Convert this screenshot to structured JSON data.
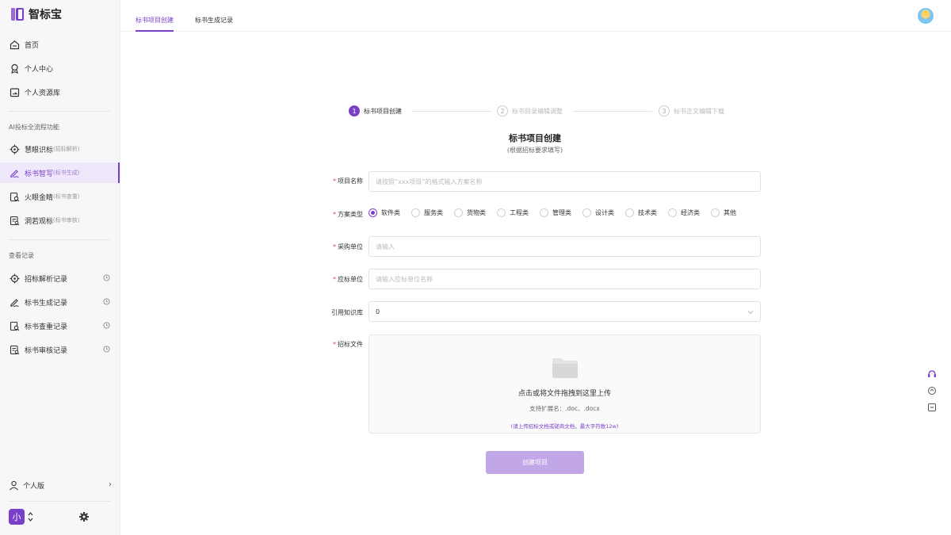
{
  "app": {
    "name": "智标宝"
  },
  "sidebar": {
    "top_items": [
      {
        "label": "首页",
        "icon": "home-icon"
      },
      {
        "label": "个人中心",
        "icon": "badge-icon"
      },
      {
        "label": "个人资源库",
        "icon": "folder-icon"
      }
    ],
    "section1_title": "AI投标全流程功能",
    "feature_items": [
      {
        "label": "慧眼识标",
        "sub": "(招标解析)",
        "icon": "target-icon"
      },
      {
        "label": "标书智写",
        "sub": "(标书生成)",
        "icon": "pen-icon"
      },
      {
        "label": "火眼金睛",
        "sub": "(标书查重)",
        "icon": "doc-search-icon"
      },
      {
        "label": "洞若观标",
        "sub": "(标书审核)",
        "icon": "doc-review-icon"
      }
    ],
    "section2_title": "查看记录",
    "record_items": [
      {
        "label": "招标解析记录",
        "icon": "target-icon"
      },
      {
        "label": "标书生成记录",
        "icon": "pen-icon"
      },
      {
        "label": "标书查重记录",
        "icon": "doc-search-icon"
      },
      {
        "label": "标书审核记录",
        "icon": "doc-review-icon"
      }
    ],
    "user_mode": "个人版",
    "avatar_char": "小"
  },
  "header": {
    "tabs": [
      {
        "label": "标书项目创建",
        "active": true
      },
      {
        "label": "标书生成记录",
        "active": false
      }
    ]
  },
  "steps": [
    {
      "num": "1",
      "label": "标书项目创建"
    },
    {
      "num": "2",
      "label": "标书目录编辑调整"
    },
    {
      "num": "3",
      "label": "标书正文编辑下载"
    }
  ],
  "form": {
    "title": "标书项目创建",
    "subtitle": "(根据招标要求填写)",
    "project_name": {
      "label": "项目名称",
      "placeholder": "请按照“xxx项目”的格式输入方案名称"
    },
    "plan_type": {
      "label": "方案类型",
      "options": [
        "软件类",
        "服务类",
        "货物类",
        "工程类",
        "管理类",
        "设计类",
        "技术类",
        "经济类",
        "其他"
      ],
      "selected": "软件类"
    },
    "purchaser": {
      "label": "采购单位",
      "placeholder": "请输入"
    },
    "bidder": {
      "label": "应标单位",
      "placeholder": "请输入应标单位名称"
    },
    "knowledge": {
      "label": "引用知识库",
      "value": "0"
    },
    "bid_file": {
      "label": "招标文件",
      "main_text": "点击或将文件拖拽到这里上传",
      "ext_text": "支持扩展名：.doc、.docx",
      "hint_text": "(请上传招标文档或磋商文档，最大字符数12w)"
    },
    "submit_label": "创建项目"
  },
  "colors": {
    "accent": "#7a3fc8",
    "button_disabled": "#c1a6e8",
    "required": "#e0474c"
  }
}
